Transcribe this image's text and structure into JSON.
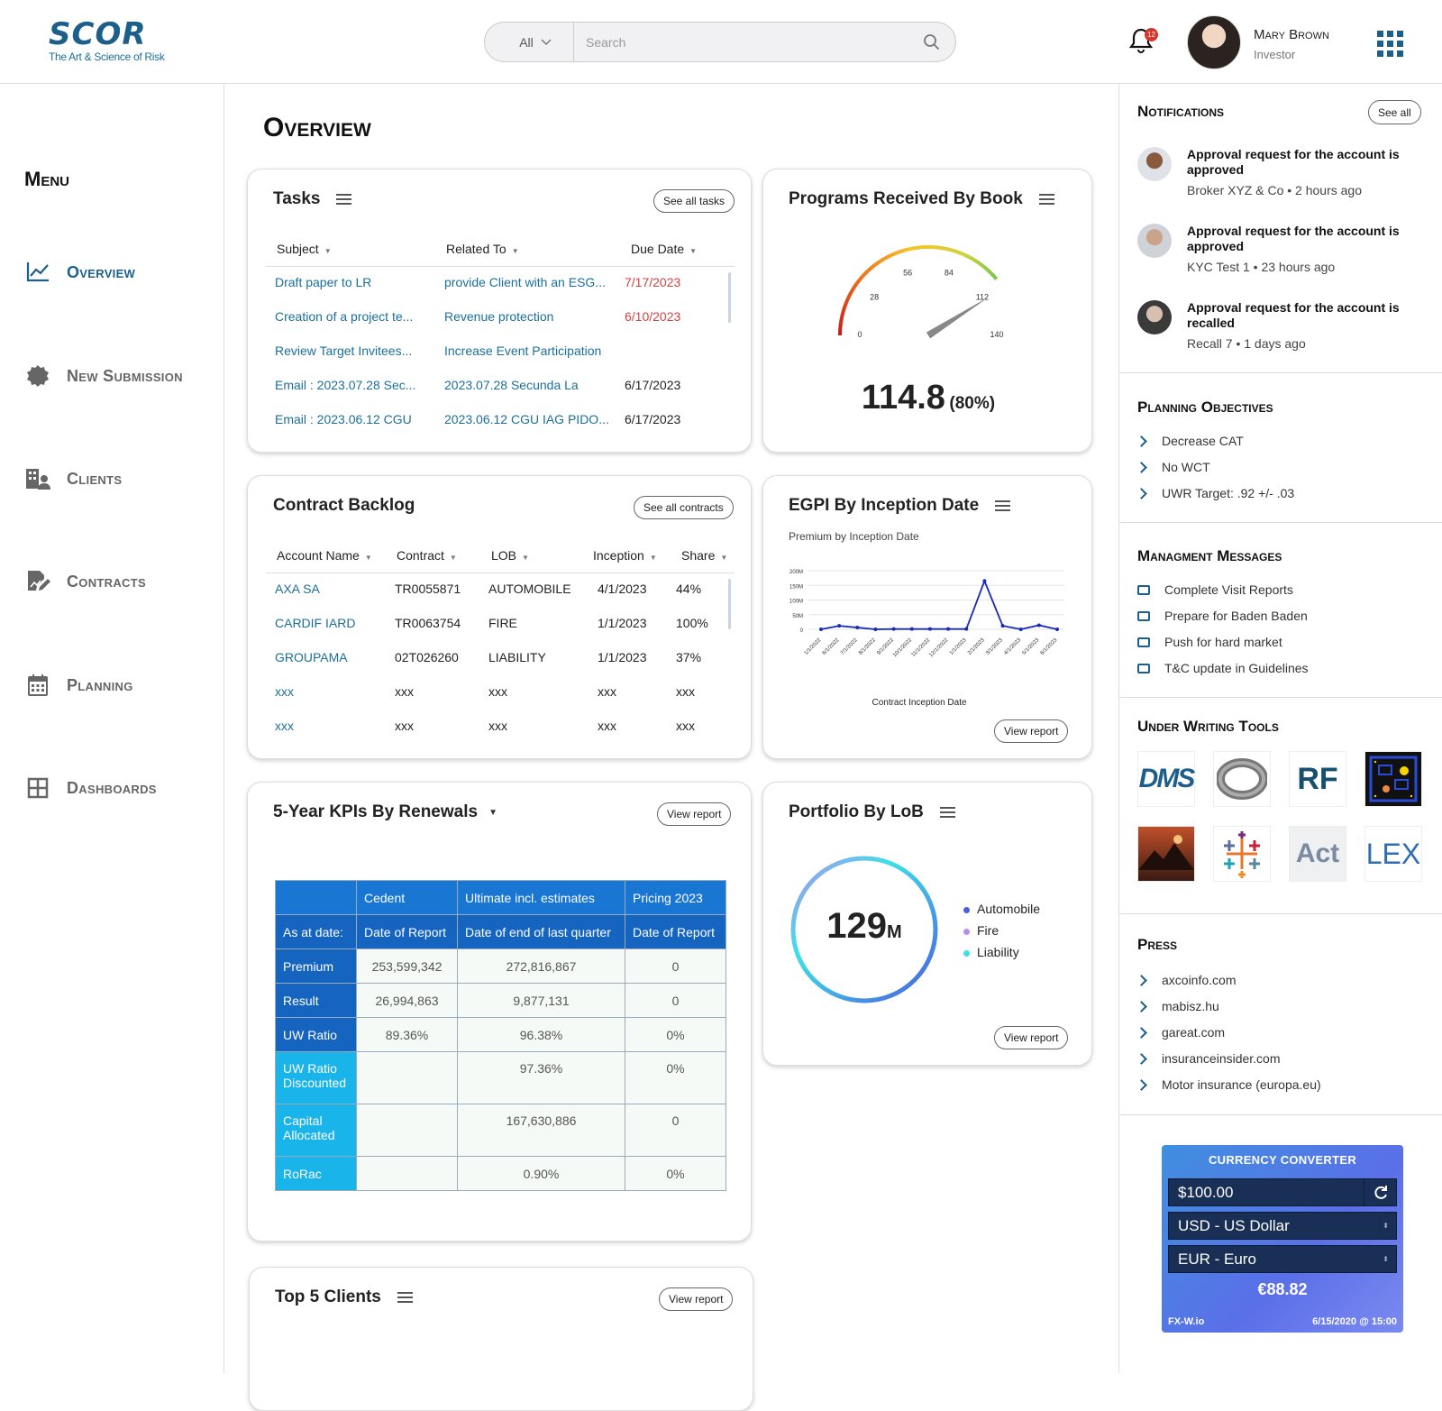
{
  "header": {
    "logo_mark": "SCOR",
    "logo_tagline": "The Art & Science of Risk",
    "search_category": "All",
    "search_placeholder": "Search",
    "notification_count": "12",
    "user_name": "Mary Brown",
    "user_role": "Investor"
  },
  "sidebar": {
    "title": "Menu",
    "items": [
      {
        "label": "Overview",
        "icon": "line-chart-icon",
        "active": true
      },
      {
        "label": "New Submission",
        "icon": "badge-icon"
      },
      {
        "label": "Clients",
        "icon": "building-icon"
      },
      {
        "label": "Contracts",
        "icon": "contract-edit-icon"
      },
      {
        "label": "Planning",
        "icon": "calendar-icon"
      },
      {
        "label": "Dashboards",
        "icon": "grid-icon"
      }
    ]
  },
  "main": {
    "title": "Overview",
    "tasks": {
      "title": "Tasks",
      "button": "See all tasks",
      "columns": [
        "Subject",
        "Related To",
        "Due Date"
      ],
      "rows": [
        {
          "subject": "Draft paper to LR",
          "related": "provide Client with an ESG...",
          "due": "7/17/2023",
          "overdue": true
        },
        {
          "subject": "Creation of a project te...",
          "related": "Revenue protection",
          "due": "6/10/2023",
          "overdue": true
        },
        {
          "subject": "Review Target Invitees...",
          "related": "Increase Event Participation",
          "due": "",
          "overdue": false
        },
        {
          "subject": "Email : 2023.07.28 Sec...",
          "related": "2023.07.28 Secunda La",
          "due": "6/17/2023",
          "overdue": false
        },
        {
          "subject": "Email : 2023.06.12 CGU",
          "related": "2023.06.12 CGU IAG PIDO...",
          "due": "6/17/2023",
          "overdue": false
        }
      ]
    },
    "programs": {
      "title": "Programs Received By Book",
      "gauge_ticks": [
        "0",
        "28",
        "56",
        "84",
        "112",
        "140"
      ],
      "gauge_value": 114.8,
      "gauge_max": 140,
      "value_text": "114.8",
      "percent_text": "(80%)"
    },
    "contracts": {
      "title": "Contract Backlog",
      "button": "See all contracts",
      "columns": [
        "Account Name",
        "Contract",
        "LOB",
        "Inception",
        "Share"
      ],
      "rows": [
        {
          "account": "AXA SA",
          "contract": "TR0055871",
          "lob": "AUTOMOBILE",
          "inception": "4/1/2023",
          "share": "44%"
        },
        {
          "account": "CARDIF IARD",
          "contract": "TR0063754",
          "lob": "FIRE",
          "inception": "1/1/2023",
          "share": "100%"
        },
        {
          "account": "GROUPAMA",
          "contract": "02T026260",
          "lob": "LIABILITY",
          "inception": "1/1/2023",
          "share": "37%"
        },
        {
          "account": "xxx",
          "contract": "xxx",
          "lob": "xxx",
          "inception": "xxx",
          "share": "xxx"
        },
        {
          "account": "xxx",
          "contract": "xxx",
          "lob": "xxx",
          "inception": "xxx",
          "share": "xxx"
        }
      ]
    },
    "egpi": {
      "title": "EGPI By Inception Date",
      "subtitle": "Premium by Inception Date",
      "button": "View report",
      "chart_data": {
        "type": "line",
        "x": [
          "1/1/2022",
          "6/1/2022",
          "7/1/2022",
          "8/1/2022",
          "9/1/2022",
          "10/1/2022",
          "11/1/2022",
          "12/1/2022",
          "1/1/2023",
          "2/1/2023",
          "3/1/2023",
          "4/1/2023",
          "5/1/2023",
          "6/1/2023"
        ],
        "values": [
          0,
          12,
          6,
          0,
          1,
          1,
          1,
          1,
          1,
          165,
          12,
          0,
          14,
          0
        ],
        "y_ticks": [
          "0",
          "50M",
          "100M",
          "150M",
          "200M"
        ],
        "ylim": [
          0,
          200
        ],
        "xlabel": "Contract Inception Date",
        "color": "#1a2ab8"
      }
    },
    "kpis": {
      "title": "5-Year KPIs By Renewals",
      "button": "View report",
      "header_top": [
        "",
        "Cedent",
        "Ultimate incl. estimates",
        "Pricing 2023"
      ],
      "header_sub": [
        "As at date:",
        "Date of Report",
        "Date of end of last quarter",
        "Date of Report"
      ],
      "rows": [
        {
          "label": "Premium",
          "c1": "253,599,342",
          "c2": "272,816,867",
          "c3": "0"
        },
        {
          "label": "Result",
          "c1": "26,994,863",
          "c2": "9,877,131",
          "c3": "0"
        },
        {
          "label": "UW Ratio",
          "c1": "89.36%",
          "c2": "96.38%",
          "c3": "0%"
        },
        {
          "label": "UW Ratio Discounted",
          "c1": "",
          "c2": "97.36%",
          "c3": "0%"
        },
        {
          "label": "Capital Allocated",
          "c1": "",
          "c2": "167,630,886",
          "c3": "0"
        },
        {
          "label": "RoRac",
          "c1": "",
          "c2": "0.90%",
          "c3": "0%"
        }
      ]
    },
    "portfolio": {
      "title": "Portfolio By LoB",
      "button": "View report",
      "total": "129",
      "unit": "M",
      "legend": [
        {
          "label": "Automobile",
          "color": "#4a5ee0"
        },
        {
          "label": "Fire",
          "color": "#b48ef0"
        },
        {
          "label": "Liability",
          "color": "#3ee0e8"
        }
      ]
    },
    "top_clients": {
      "title": "Top 5 Clients",
      "button": "View report"
    }
  },
  "right": {
    "notifications": {
      "title": "Notifications",
      "button": "See all",
      "items": [
        {
          "title": "Approval request for the account is approved",
          "meta": "Broker XYZ & Co • 2 hours ago"
        },
        {
          "title": "Approval request for the account is approved",
          "meta": "KYC Test 1 • 23 hours ago"
        },
        {
          "title": "Approval request for the account is recalled",
          "meta": "Recall 7 • 1 days ago"
        }
      ]
    },
    "planning": {
      "title": "Planning Objectives",
      "items": [
        "Decrease CAT",
        "No WCT",
        "UWR Target: .92 +/- .03"
      ]
    },
    "messages": {
      "title": "Managment Messages",
      "items": [
        "Complete Visit Reports",
        "Prepare for Baden Baden",
        "Push for hard market",
        "T&C update in Guidelines"
      ]
    },
    "tools": {
      "title": "Under Writing Tools",
      "items": [
        "DMS",
        "ring-logo",
        "RF",
        "pacman-game",
        "mountain-photo",
        "tableau-logo",
        "Act",
        "LEX"
      ]
    },
    "press": {
      "title": "Press",
      "items": [
        "axcoinfo.com",
        "mabisz.hu",
        "gareat.com",
        "insuranceinsider.com",
        "Motor insurance (europa.eu)"
      ]
    },
    "converter": {
      "title": "CURRENCY CONVERTER",
      "amount": "$100.00",
      "from": "USD - US Dollar",
      "to": "EUR - Euro",
      "result": "€88.82",
      "source": "FX-W.io",
      "timestamp": "6/15/2020 @ 15:00"
    }
  }
}
